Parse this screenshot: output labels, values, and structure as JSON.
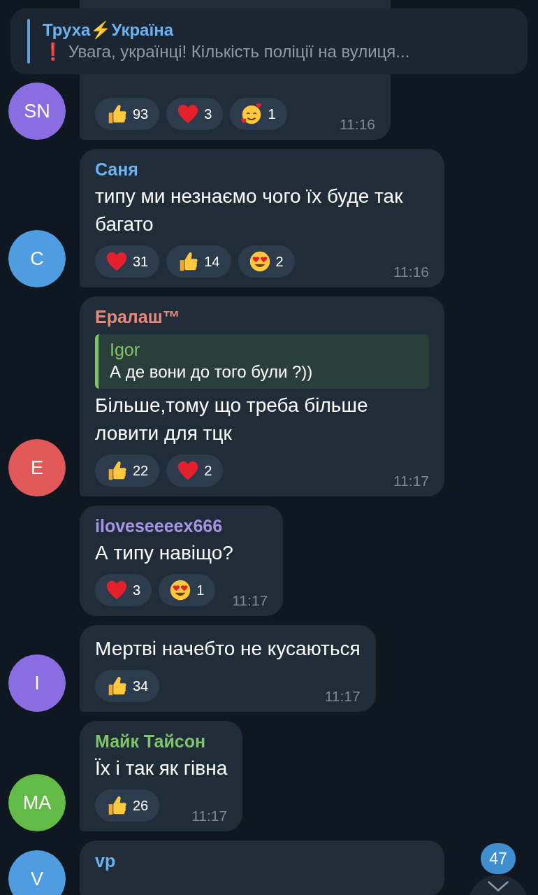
{
  "pinned": {
    "title": "Труха⚡Україна",
    "text": "❗ Увага, українці! Кількість поліції на вулиця..."
  },
  "messages": [
    {
      "avatar": {
        "initials": "SN",
        "color": "#8a6de0"
      },
      "reactions": [
        {
          "kind": "thumbs",
          "count": "93"
        },
        {
          "kind": "heart",
          "count": "3"
        },
        {
          "kind": "hearts-face",
          "count": "1"
        }
      ],
      "time": "11:16"
    },
    {
      "avatar": {
        "initials": "C",
        "color": "#4f9de0"
      },
      "sender": "Саня",
      "color": "#6ab3f3",
      "text": "типу ми незнаємо чого їх буде так багато",
      "reactions": [
        {
          "kind": "heart",
          "count": "31"
        },
        {
          "kind": "thumbs",
          "count": "14"
        },
        {
          "kind": "heart-eyes",
          "count": "2"
        }
      ],
      "time": "11:16"
    },
    {
      "avatar": {
        "initials": "E",
        "color": "#e05858"
      },
      "sender": "Ералаш™",
      "color": "#e88b7d",
      "reply": {
        "name": "Igor",
        "text": "А де вони до того були ?))",
        "color": "#7fc36b"
      },
      "text": "Більше,тому що треба більше ловити для тцк",
      "reactions": [
        {
          "kind": "thumbs",
          "count": "22"
        },
        {
          "kind": "heart",
          "count": "2"
        }
      ],
      "time": "11:17"
    },
    {
      "sender": "iloveseeeex666",
      "color": "#a695e7",
      "text": "А типу навіщо?",
      "reactions": [
        {
          "kind": "heart",
          "count": "3"
        },
        {
          "kind": "heart-eyes",
          "count": "1"
        }
      ],
      "time": "11:17"
    },
    {
      "avatar": {
        "initials": "I",
        "color": "#8a6de0"
      },
      "text": "Мертві начебто не кусаються",
      "reactions": [
        {
          "kind": "thumbs",
          "count": "34"
        }
      ],
      "time": "11:17"
    },
    {
      "avatar": {
        "initials": "MA",
        "color": "#62bb47"
      },
      "sender": "Майк Тайсон",
      "color": "#7fc36b",
      "text": "Їх і так як гівна",
      "reactions": [
        {
          "kind": "thumbs",
          "count": "26"
        }
      ],
      "time": "11:17"
    },
    {
      "avatar": {
        "initials": "V",
        "color": "#4f9de0"
      },
      "sender": "vp",
      "color": "#6ab3f3"
    }
  ],
  "unread_badge": "47"
}
